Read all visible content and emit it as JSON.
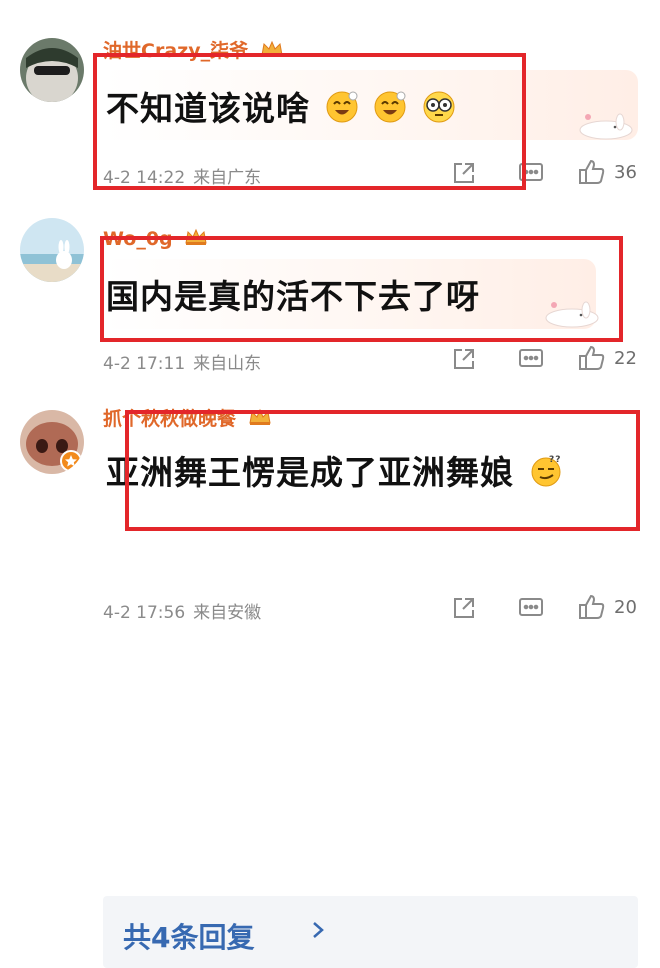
{
  "comments": [
    {
      "username": "油世Crazy_柒爷",
      "text": "不知道该说啥",
      "date_time": "4-2 14:22",
      "location": "来自广东",
      "likes": "36"
    },
    {
      "username": "Wo_0g",
      "text": "国内是真的活不下去了呀",
      "date_time": "4-2 17:11",
      "location": "来自山东",
      "likes": "22"
    },
    {
      "username": "抓个秋秋做晚餐",
      "text": "亚洲舞王愣是成了亚洲舞娘",
      "date_time": "4-2 17:56",
      "location": "来自安徽",
      "likes": "20",
      "replies_label": "共4条回复"
    }
  ],
  "colors": {
    "username": "#e0682a",
    "highlight_box": "#e3262a",
    "reply_link": "#3769b1",
    "meta_text": "#8a8a8a"
  },
  "icons": [
    "crown-icon",
    "share-icon",
    "comment-icon",
    "thumbs-up-icon",
    "emoji-icon",
    "chevron-right-icon",
    "bunny-sticker-icon"
  ]
}
